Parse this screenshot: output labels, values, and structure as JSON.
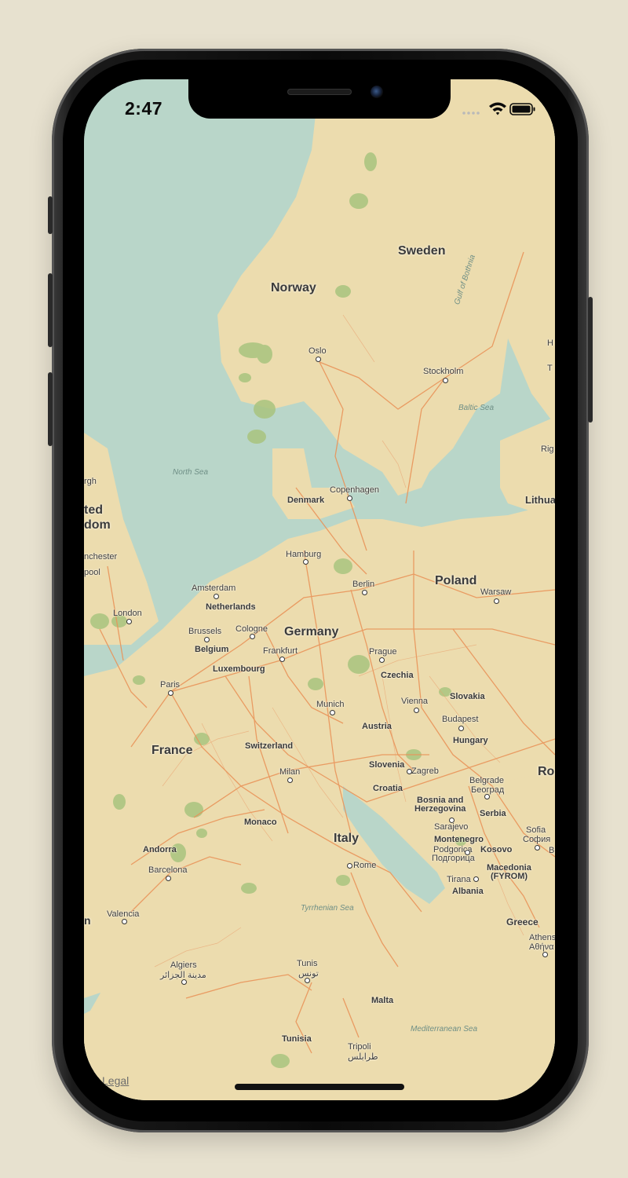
{
  "status_bar": {
    "time": "2:47"
  },
  "map": {
    "legal_label": "Legal",
    "countries": {
      "sweden": "Sweden",
      "norway": "Norway",
      "united_kingdom_partial_1": "ted",
      "united_kingdom_partial_2": "dom",
      "denmark": "Denmark",
      "netherlands": "Netherlands",
      "belgium": "Belgium",
      "luxembourg": "Luxembourg",
      "germany": "Germany",
      "poland": "Poland",
      "lithuania_partial": "Lithua",
      "czechia": "Czechia",
      "slovakia": "Slovakia",
      "austria": "Austria",
      "hungary": "Hungary",
      "romania_partial": "Ro",
      "france": "France",
      "switzerland": "Switzerland",
      "slovenia": "Slovenia",
      "croatia": "Croatia",
      "bosnia_1": "Bosnia and",
      "bosnia_2": "Herzegovina",
      "serbia": "Serbia",
      "monaco": "Monaco",
      "andorra": "Andorra",
      "italy": "Italy",
      "montenegro": "Montenegro",
      "kosovo": "Kosovo",
      "macedonia_1": "Macedonia",
      "macedonia_2": "(FYROM)",
      "albania": "Albania",
      "greece": "Greece",
      "malta": "Malta",
      "tunisia": "Tunisia"
    },
    "cities": {
      "oslo": "Oslo",
      "stockholm": "Stockholm",
      "copenhagen": "Copenhagen",
      "hamburg": "Hamburg",
      "berlin": "Berlin",
      "warsaw": "Warsaw",
      "amsterdam": "Amsterdam",
      "manchester_partial": "nchester",
      "liverpool_partial": "pool",
      "edinburgh_partial": "rgh",
      "london": "London",
      "brussels": "Brussels",
      "cologne": "Cologne",
      "frankfurt": "Frankfurt",
      "prague": "Prague",
      "paris": "Paris",
      "munich": "Munich",
      "vienna": "Vienna",
      "budapest": "Budapest",
      "zagreb": "Zagreb",
      "milan": "Milan",
      "belgrade": "Belgrade",
      "belgrade_cyr": "Београд",
      "sarajevo": "Sarajevo",
      "sofia": "Sofia",
      "sofia_cyr": "София",
      "podgorica": "Podgorica",
      "podgorica_cyr": "Подгорица",
      "rome": "Rome",
      "tirana": "Tirana",
      "barcelona": "Barcelona",
      "valencia": "Valencia",
      "athens": "Athens",
      "athens_gr": "Αθήνα",
      "algiers": "Algiers",
      "algiers_ar": "مدينة الجزائر",
      "tunis": "Tunis",
      "tunis_ar": "تونس",
      "tripoli": "Tripoli",
      "tripoli_ar": "طرابلس",
      "riga_partial": "Rig",
      "helsinki_partial": "H",
      "tallinn_partial": "T",
      "madrid_partial": "n",
      "istanbul_partial": "B"
    },
    "seas": {
      "north_sea": "North Sea",
      "baltic_sea": "Baltic Sea",
      "gulf_of_bothnia": "Gulf of Bothnia",
      "tyrrhenian_sea": "Tyrrhenian Sea",
      "mediterranean_sea": "Mediterranean Sea"
    },
    "colors": {
      "water": "#b9d6c9",
      "land": "#ecdcae",
      "forest": "#a9c47f",
      "road": "#e9945a"
    }
  }
}
